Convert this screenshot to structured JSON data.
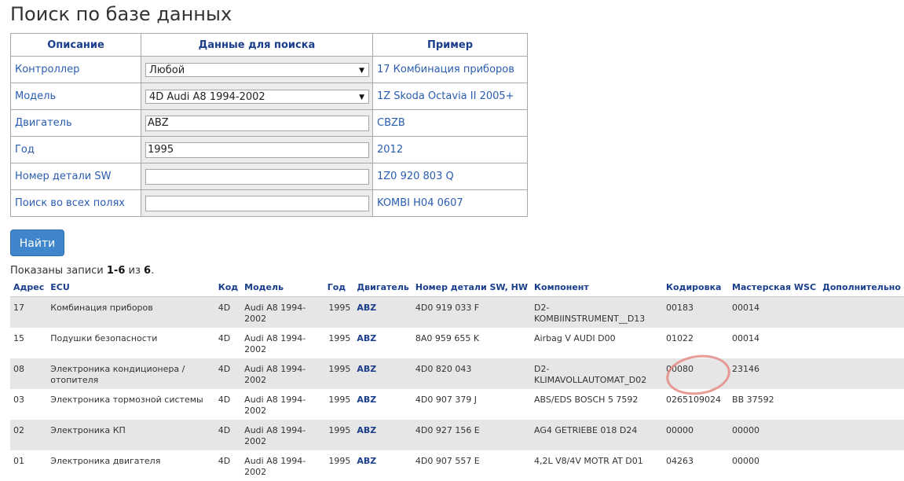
{
  "page": {
    "title": "Поиск по базе данных"
  },
  "form": {
    "headers": [
      "Описание",
      "Данные для поиска",
      "Пример"
    ],
    "rows": [
      {
        "label": "Контроллер",
        "type": "select",
        "value": "Любой",
        "example": "17 Комбинация приборов"
      },
      {
        "label": "Модель",
        "type": "select",
        "value": "4D Audi A8 1994-2002",
        "example": "1Z Skoda Octavia II 2005+"
      },
      {
        "label": "Двигатель",
        "type": "text",
        "value": "ABZ",
        "example": "CBZB"
      },
      {
        "label": "Год",
        "type": "text",
        "value": "1995",
        "example": "2012"
      },
      {
        "label": "Номер детали SW",
        "type": "text",
        "value": "",
        "example": "1Z0 920 803 Q"
      },
      {
        "label": "Поиск во всех полях",
        "type": "text",
        "value": "",
        "example": "KOMBI H04 0607"
      }
    ],
    "submit_label": "Найти"
  },
  "summary": {
    "prefix": "Показаны записи ",
    "range": "1-6",
    "middle": " из ",
    "total": "6",
    "suffix": "."
  },
  "results": {
    "headers": [
      "Адрес",
      "ECU",
      "Код",
      "Модель",
      "Год",
      "Двигатель",
      "Номер детали SW, HW",
      "Компонент",
      "Кодировка",
      "Мастерская WSC",
      "Дополнительно"
    ],
    "rows": [
      [
        "17",
        "Комбинация приборов",
        "4D",
        "Audi A8 1994-2002",
        "1995",
        "ABZ",
        "4D0 919 033 F",
        "D2-KOMBIINSTRUMENT__D13",
        "00183",
        "00014",
        ""
      ],
      [
        "15",
        "Подушки безопасности",
        "4D",
        "Audi A8 1994-2002",
        "1995",
        "ABZ",
        "8A0 959 655 K",
        "Airbag V AUDI D00",
        "01022",
        "00014",
        ""
      ],
      [
        "08",
        "Электроника кондиционера / отопителя",
        "4D",
        "Audi A8 1994-2002",
        "1995",
        "ABZ",
        "4D0 820 043",
        "D2-KLIMAVOLLAUTOMAT_D02",
        "00080",
        "23146",
        ""
      ],
      [
        "03",
        "Электроника тормозной системы",
        "4D",
        "Audi A8 1994-2002",
        "1995",
        "ABZ",
        "4D0 907 379 J",
        "ABS/EDS BOSCH 5 7592",
        "0265109024",
        "BB 37592",
        ""
      ],
      [
        "02",
        "Электроника КП",
        "4D",
        "Audi A8 1994-2002",
        "1995",
        "ABZ",
        "4D0 927 156 E",
        "AG4 GETRIEBE 018 D24",
        "00000",
        "00000",
        ""
      ],
      [
        "01",
        "Электроника двигателя",
        "4D",
        "Audi A8 1994-2002",
        "1995",
        "ABZ",
        "4D0 907 557 E",
        "4,2L V8/4V MOTR AT D01",
        "04263",
        "00000",
        ""
      ]
    ]
  },
  "colors": {
    "accent": "#3f86cd",
    "link": "#2a5db0",
    "header": "#1a3e8c",
    "highlight_circle": "#e58a86"
  }
}
